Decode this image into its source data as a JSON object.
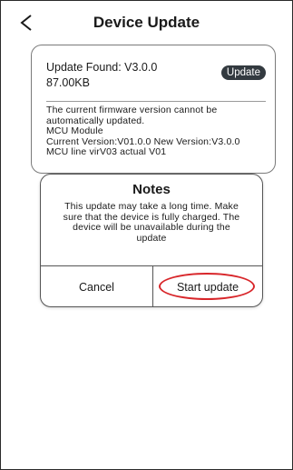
{
  "header": {
    "title": "Device Update",
    "back_icon": "chevron-left-icon"
  },
  "update_card": {
    "found_text": "Update Found: V3.0.0",
    "size_text": "87.00KB",
    "update_button_label": "Update",
    "description_lines": [
      "The current firmware version cannot be",
      "automatically updated.",
      "MCU Module",
      "Current Version:V01.0.0  New Version:V3.0.0",
      "MCU line virV03 actual V01"
    ]
  },
  "dialog": {
    "title": "Notes",
    "message_lines": [
      "This update may take a long time. Make",
      "sure that the device is fully charged. The",
      "device will be unavailable during the",
      "update"
    ],
    "cancel_label": "Cancel",
    "start_label": "Start update"
  },
  "colors": {
    "update_button_bg": "#333a40",
    "highlight_ring": "#d8262a"
  }
}
